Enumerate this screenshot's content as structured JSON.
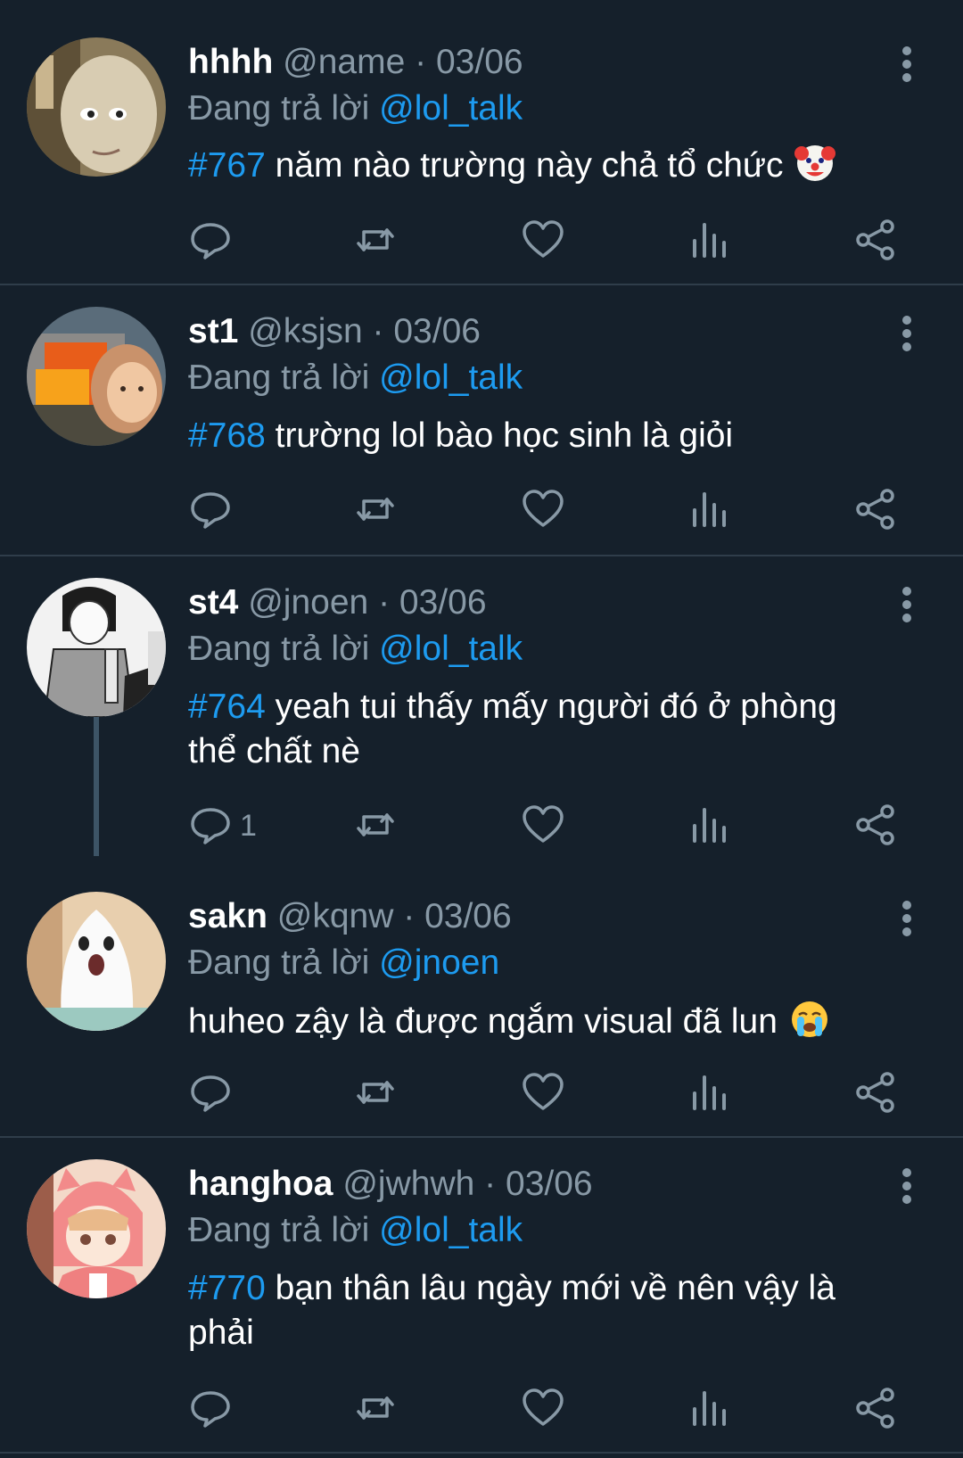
{
  "colors": {
    "background": "#15202b",
    "accent": "#1d9bf0",
    "muted": "#8899a6",
    "divider": "#2f3d4a"
  },
  "replying_prefix": "Đang trả lời",
  "tweets": [
    {
      "name": "hhhh",
      "handle": "@name",
      "dot": "·",
      "date": "03/06",
      "reply_to": "@lol_talk",
      "hashtag": "#767",
      "text": "năm nào trường này chả tổ chức",
      "emoji": "clown-face",
      "reply_count": ""
    },
    {
      "name": "st1",
      "handle": "@ksjsn",
      "dot": "·",
      "date": "03/06",
      "reply_to": "@lol_talk",
      "hashtag": "#768",
      "text": "trường lol bào học sinh là giỏi",
      "reply_count": ""
    },
    {
      "name": "st4",
      "handle": "@jnoen",
      "dot": "·",
      "date": "03/06",
      "reply_to": "@lol_talk",
      "hashtag": "#764",
      "text": "yeah tui thấy mấy người đó ở phòng thể chất nè",
      "reply_count": "1"
    },
    {
      "name": "sakn",
      "handle": "@kqnw",
      "dot": "·",
      "date": "03/06",
      "reply_to": "@jnoen",
      "hashtag": "",
      "text": "huheo zậy là được ngắm visual đã lun",
      "emoji": "crying-face",
      "reply_count": ""
    },
    {
      "name": "hanghoa",
      "handle": "@jwhwh",
      "dot": "·",
      "date": "03/06",
      "reply_to": "@lol_talk",
      "hashtag": "#770",
      "text": "bạn thân lâu ngày mới về nên vậy là phải",
      "reply_count": ""
    }
  ],
  "action_icons": [
    "reply-icon",
    "retweet-icon",
    "like-icon",
    "views-icon",
    "share-icon"
  ]
}
